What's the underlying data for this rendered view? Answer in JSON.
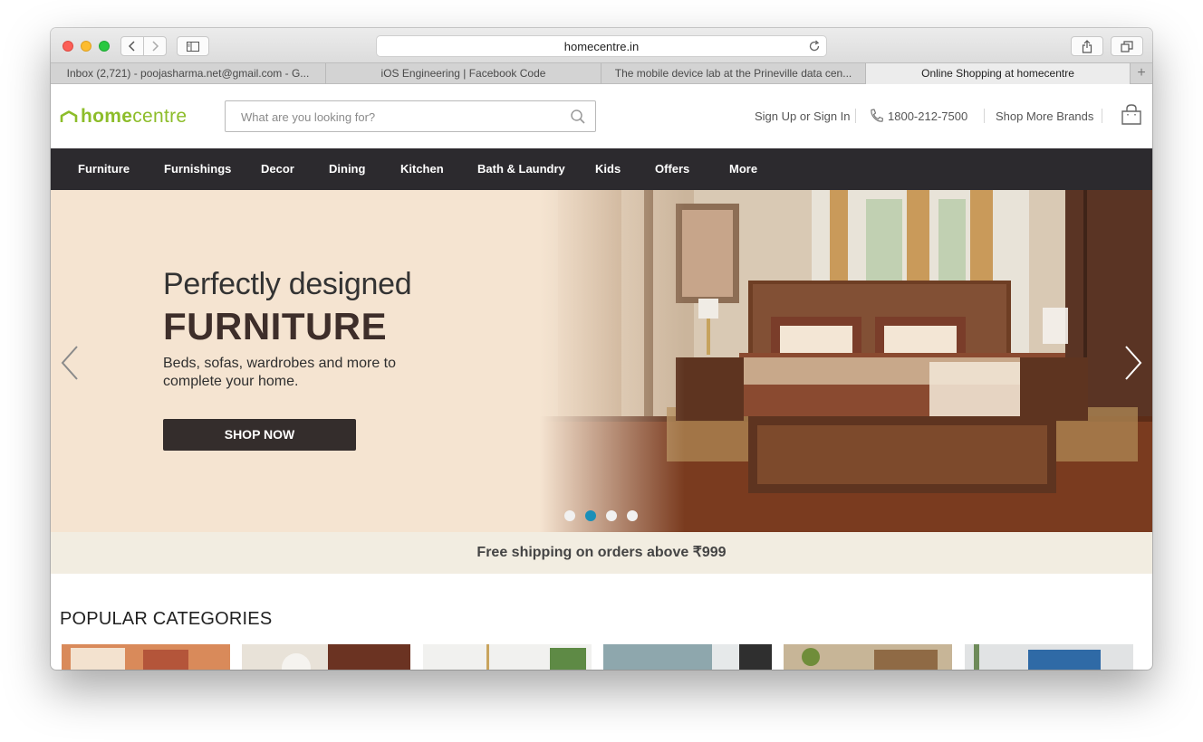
{
  "browser": {
    "url": "homecentre.in",
    "tabs": [
      {
        "title": "Inbox (2,721) - poojasharma.net@gmail.com - G...",
        "active": false
      },
      {
        "title": "iOS Engineering | Facebook Code",
        "active": false
      },
      {
        "title": "The mobile device lab at the Prineville data cen...",
        "active": false
      },
      {
        "title": "Online Shopping at homecentre",
        "active": true
      }
    ],
    "new_tab": "+"
  },
  "header": {
    "logo_home": "home",
    "logo_centre": "centre",
    "search_placeholder": "What are you looking for?",
    "signin": "Sign Up or Sign In",
    "phone": "1800-212-7500",
    "brands": "Shop More Brands"
  },
  "nav": {
    "items": [
      "Furniture",
      "Furnishings",
      "Decor",
      "Dining",
      "Kitchen",
      "Bath & Laundry",
      "Kids",
      "Offers",
      "More"
    ]
  },
  "hero": {
    "title_line1": "Perfectly designed",
    "title_line2": "FURNITURE",
    "subtitle": "Beds, sofas, wardrobes and more to complete your home.",
    "cta": "SHOP NOW",
    "slide_count": 4,
    "active_slide": 2
  },
  "banner": {
    "text": "Free shipping on orders above ₹999"
  },
  "popular": {
    "title": "POPULAR CATEGORIES"
  },
  "colors": {
    "brand_green": "#8dbd2a",
    "nav_bg": "#2c2a2e",
    "hero_bg": "#f5e4d1",
    "dot_active": "#1a8fb8",
    "banner_bg": "#f2ede1"
  }
}
